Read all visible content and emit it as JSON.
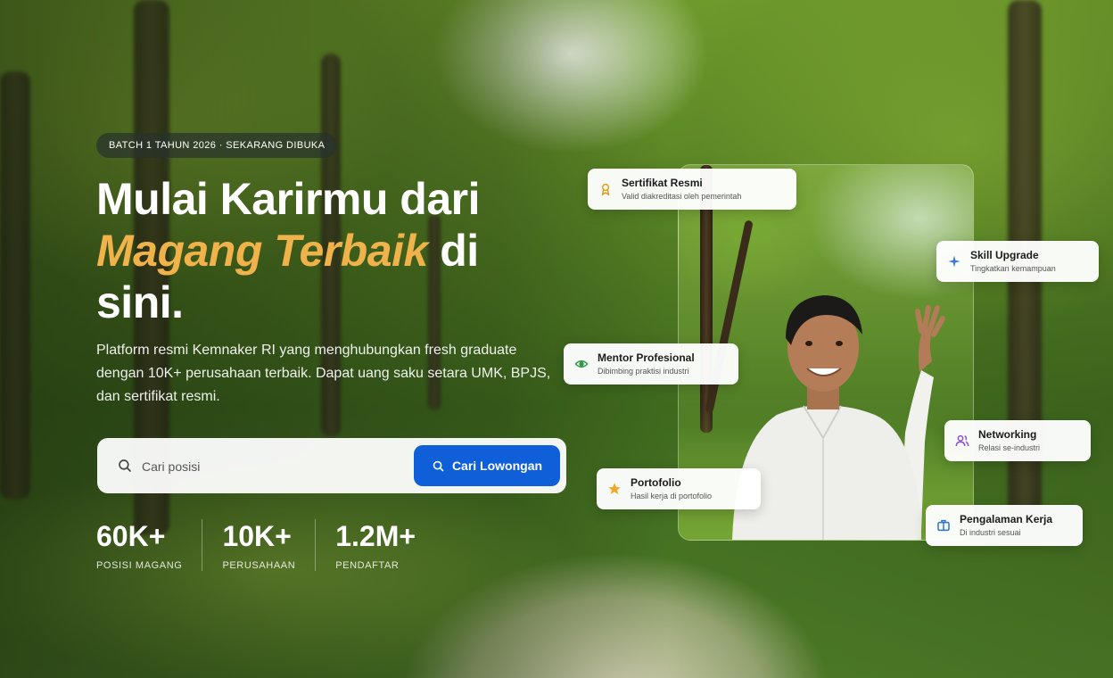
{
  "hero": {
    "badge": "BATCH 1 TAHUN 2026 · SEKARANG DIBUKA",
    "headline_line1": "Mulai Karirmu dari",
    "headline_accent": "Magang Terbaik",
    "headline_mid": " di",
    "headline_line3": "sini.",
    "subtitle": "Platform resmi Kemnaker RI yang menghubungkan fresh graduate dengan 10K+ perusahaan terbaik. Dapat uang saku setara UMK, BPJS, dan sertifikat resmi.",
    "accent_color": "#f0b24a"
  },
  "search": {
    "placeholder": "Cari posisi",
    "button_label": "Cari Lowongan",
    "button_color": "#0f5fd8",
    "search_icon": "search-icon"
  },
  "stats": [
    {
      "value": "60K+",
      "label": "POSISI MAGANG"
    },
    {
      "value": "10K+",
      "label": "PERUSAHAAN"
    },
    {
      "value": "1.2M+",
      "label": "PENDAFTAR"
    }
  ],
  "chips": [
    {
      "title": "Sertifikat Resmi",
      "desc": "Valid diakreditasi oleh pemerintah",
      "icon": "award-icon"
    },
    {
      "title": "Skill Upgrade",
      "desc": "Tingkatkan kemampuan",
      "icon": "sparkle-icon"
    },
    {
      "title": "Mentor Profesional",
      "desc": "Dibimbing praktisi industri",
      "icon": "eye-icon"
    },
    {
      "title": "Networking",
      "desc": "Relasi se-industri",
      "icon": "users-icon"
    },
    {
      "title": "Portofolio",
      "desc": "Hasil kerja di portofolio",
      "icon": "star-icon"
    },
    {
      "title": "Pengalaman Kerja",
      "desc": "Di industri sesuai",
      "icon": "briefcase-icon"
    }
  ]
}
